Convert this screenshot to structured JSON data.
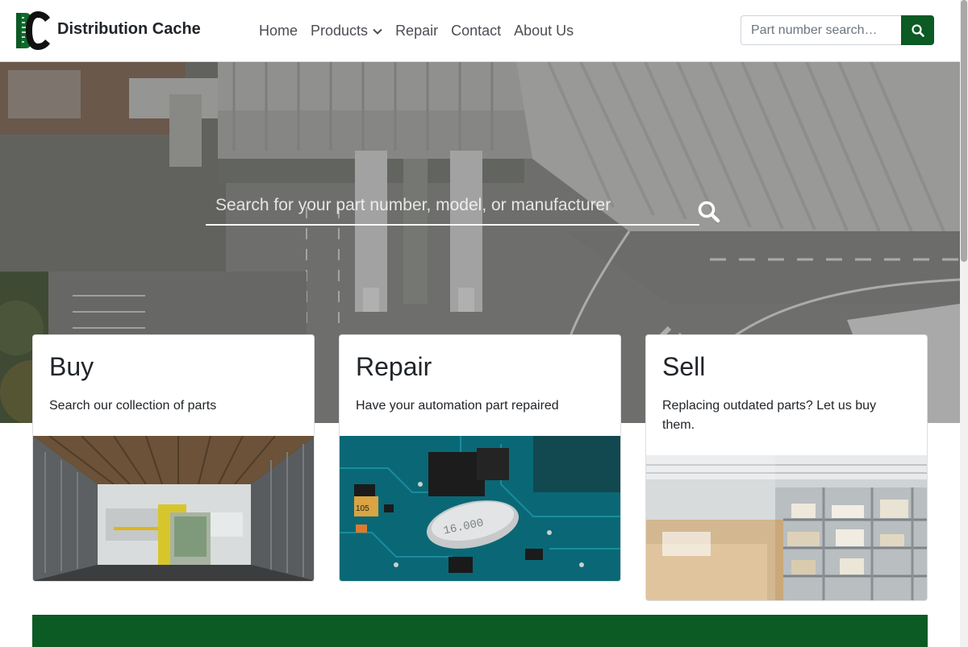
{
  "brand": {
    "name": "Distribution Cache",
    "logo_icon": "dc-logo-icon"
  },
  "nav": {
    "items": [
      {
        "label": "Home"
      },
      {
        "label": "Products",
        "has_dropdown": true
      },
      {
        "label": "Repair"
      },
      {
        "label": "Contact"
      },
      {
        "label": "About Us"
      }
    ],
    "search": {
      "placeholder": "Part number search…",
      "button_icon": "search-icon"
    }
  },
  "hero": {
    "search": {
      "placeholder": "Search for your part number, model, or manufacturer",
      "icon": "search-icon"
    }
  },
  "cards": [
    {
      "title": "Buy",
      "text": "Search our collection of parts",
      "image": "truck-forklift-image"
    },
    {
      "title": "Repair",
      "text": "Have your automation part repaired",
      "image": "circuit-board-image"
    },
    {
      "title": "Sell",
      "text": "Replacing outdated parts? Let us buy them.",
      "image": "warehouse-shelves-image"
    }
  ],
  "colors": {
    "brand_green": "#0c5a24",
    "text": "#212529",
    "nav_text": "#4a4f55"
  }
}
